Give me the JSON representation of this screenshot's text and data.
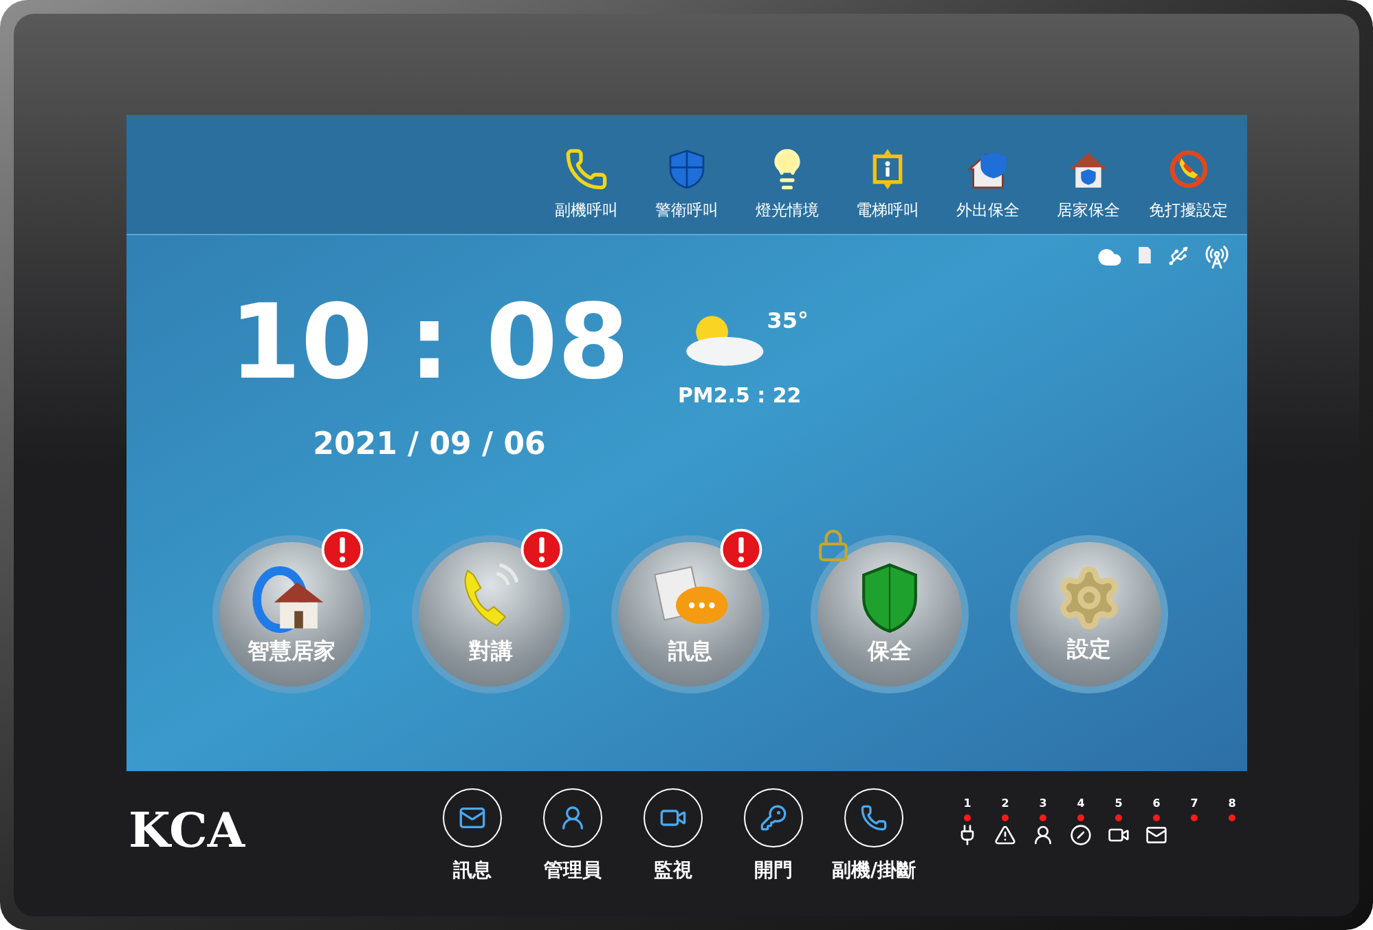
{
  "quick_bar": {
    "items": [
      {
        "label": "副機呼叫"
      },
      {
        "label": "警衛呼叫"
      },
      {
        "label": "燈光情境"
      },
      {
        "label": "電梯呼叫"
      },
      {
        "label": "外出保全"
      },
      {
        "label": "居家保全"
      },
      {
        "label": "免打擾設定"
      }
    ]
  },
  "clock": {
    "time": "10 : 08",
    "date": "2021 / 09 / 06"
  },
  "weather": {
    "temperature": "35°",
    "pm25": "PM2.5 : 22"
  },
  "main_buttons": [
    {
      "label": "智慧居家",
      "alert": true,
      "locked": false
    },
    {
      "label": "對講",
      "alert": true,
      "locked": false
    },
    {
      "label": "訊息",
      "alert": true,
      "locked": false
    },
    {
      "label": "保全",
      "alert": false,
      "locked": true
    },
    {
      "label": "設定",
      "alert": false,
      "locked": false
    }
  ],
  "device": {
    "logo": "KCA",
    "buttons": [
      {
        "label": "訊息"
      },
      {
        "label": "管理員"
      },
      {
        "label": "監視"
      },
      {
        "label": "開門"
      },
      {
        "label": "副機/掛斷"
      }
    ],
    "indicators": [
      {
        "label": "1",
        "lit": true
      },
      {
        "label": "2",
        "lit": true
      },
      {
        "label": "3",
        "lit": true
      },
      {
        "label": "4",
        "lit": true
      },
      {
        "label": "5",
        "lit": true
      },
      {
        "label": "6",
        "lit": true
      },
      {
        "label": "7",
        "lit": true
      },
      {
        "label": "8",
        "lit": true
      }
    ]
  }
}
